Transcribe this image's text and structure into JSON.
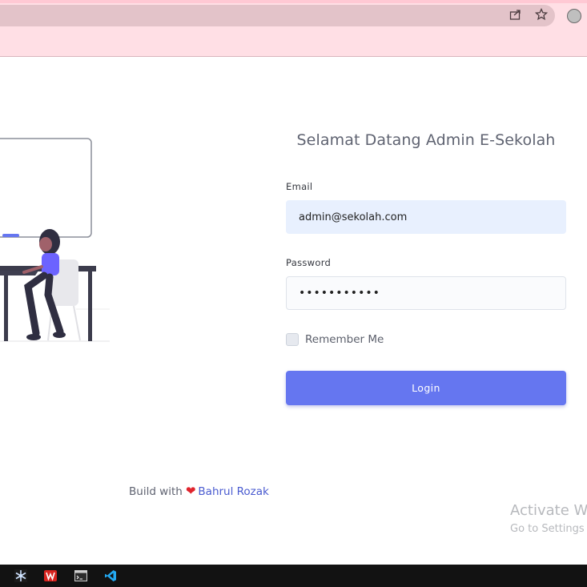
{
  "browser": {
    "icons": [
      "share-icon",
      "star-icon",
      "profile-icon"
    ]
  },
  "login": {
    "title": "Selamat Datang Admin E-Sekolah",
    "email_label": "Email",
    "email_value": "admin@sekolah.com",
    "password_label": "Password",
    "password_value": "password123",
    "remember_label": "Remember Me",
    "remember_checked": false,
    "login_button": "Login"
  },
  "footer": {
    "prefix": "Build with",
    "heart": "❤",
    "author": "Bahrul Rozak"
  },
  "watermark": {
    "title": "Activate W",
    "subtitle": "Go to Settings"
  },
  "taskbar": {
    "icons": [
      "snowflake-app-icon",
      "wps-office-icon",
      "terminal-icon",
      "vscode-icon"
    ]
  },
  "colors": {
    "primary": "#6576f0",
    "chrome": "#ffdfe5",
    "title": "#5f6371",
    "link": "#4a5bd0"
  }
}
